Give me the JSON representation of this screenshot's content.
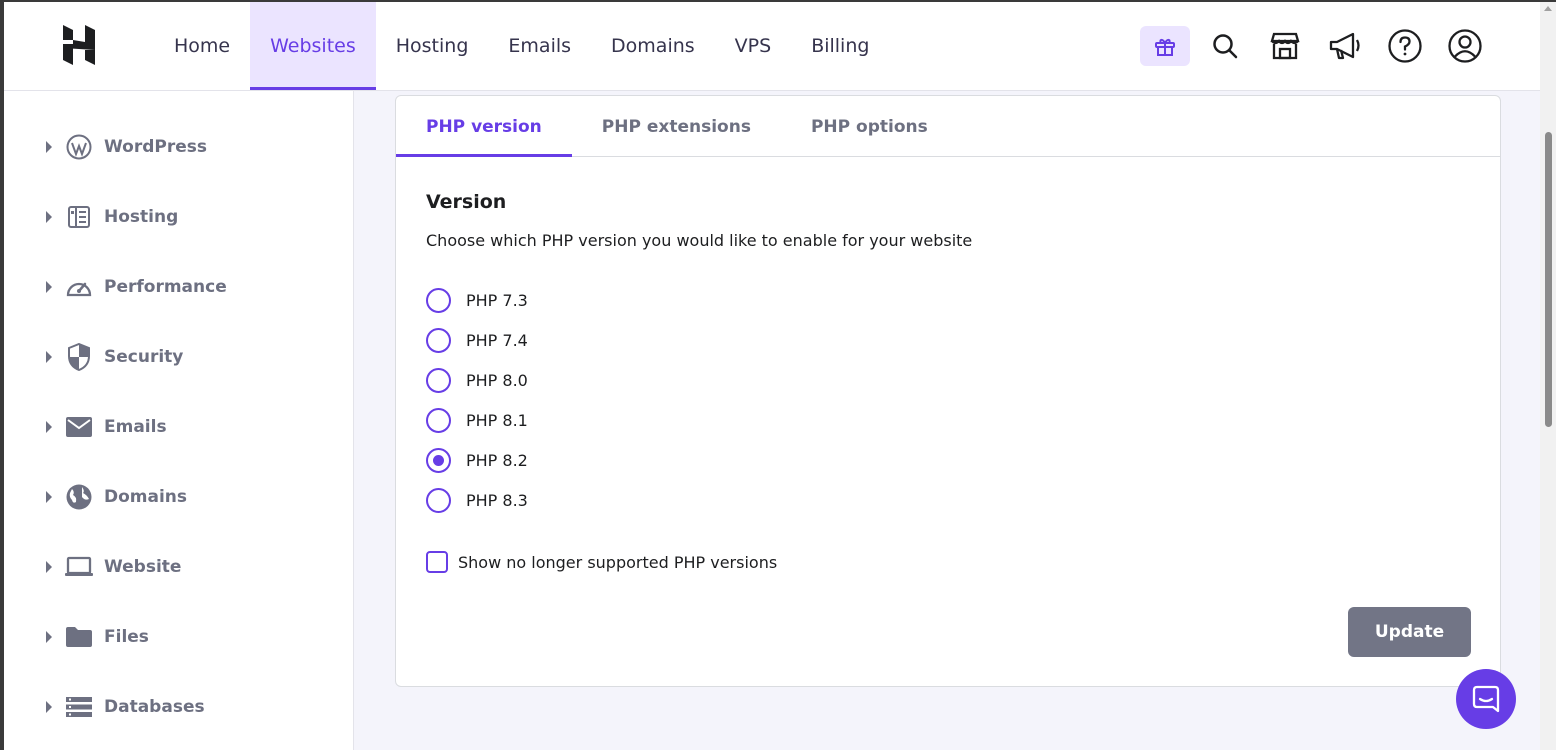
{
  "topnav": {
    "items": [
      {
        "label": "Home",
        "active": false
      },
      {
        "label": "Websites",
        "active": true
      },
      {
        "label": "Hosting",
        "active": false
      },
      {
        "label": "Emails",
        "active": false
      },
      {
        "label": "Domains",
        "active": false
      },
      {
        "label": "VPS",
        "active": false
      },
      {
        "label": "Billing",
        "active": false
      }
    ],
    "icons": [
      "gift-icon",
      "search-icon",
      "store-icon",
      "megaphone-icon",
      "help-icon",
      "account-icon"
    ]
  },
  "sidebar": {
    "items": [
      {
        "label": "WordPress",
        "icon": "wordpress-icon"
      },
      {
        "label": "Hosting",
        "icon": "server-icon"
      },
      {
        "label": "Performance",
        "icon": "gauge-icon"
      },
      {
        "label": "Security",
        "icon": "shield-icon"
      },
      {
        "label": "Emails",
        "icon": "envelope-icon"
      },
      {
        "label": "Domains",
        "icon": "globe-icon"
      },
      {
        "label": "Website",
        "icon": "laptop-icon"
      },
      {
        "label": "Files",
        "icon": "folder-icon"
      },
      {
        "label": "Databases",
        "icon": "database-icon"
      }
    ]
  },
  "tabs": [
    {
      "label": "PHP version",
      "active": true
    },
    {
      "label": "PHP extensions",
      "active": false
    },
    {
      "label": "PHP options",
      "active": false
    }
  ],
  "version": {
    "title": "Version",
    "description": "Choose which PHP version you would like to enable for your website",
    "options": [
      {
        "label": "PHP 7.3",
        "selected": false
      },
      {
        "label": "PHP 7.4",
        "selected": false
      },
      {
        "label": "PHP 8.0",
        "selected": false
      },
      {
        "label": "PHP 8.1",
        "selected": false
      },
      {
        "label": "PHP 8.2",
        "selected": true
      },
      {
        "label": "PHP 8.3",
        "selected": false
      }
    ],
    "show_unsupported_label": "Show no longer supported PHP versions",
    "show_unsupported_checked": false,
    "update_label": "Update"
  },
  "colors": {
    "accent": "#673de6",
    "accent_light": "#ebe4ff",
    "button_disabled": "#727586"
  }
}
